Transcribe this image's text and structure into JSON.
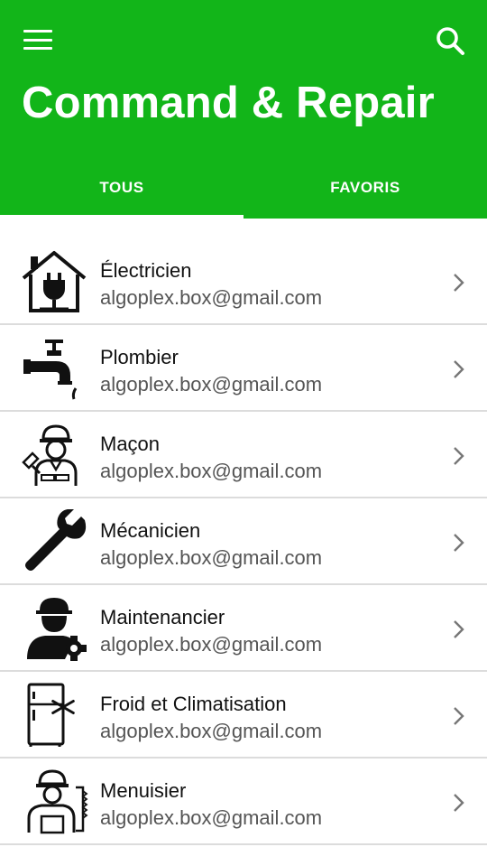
{
  "app": {
    "title": "Command & Repair",
    "accent_color": "#12b519",
    "menu_icon": "hamburger-menu-icon",
    "search_icon": "search-icon"
  },
  "tabs": [
    {
      "label": "TOUS",
      "active": true
    },
    {
      "label": "FAVORIS",
      "active": false
    }
  ],
  "items": [
    {
      "name": "Électricien",
      "email": "algoplex.box@gmail.com",
      "icon": "house-plug-icon"
    },
    {
      "name": "Plombier",
      "email": "algoplex.box@gmail.com",
      "icon": "faucet-icon"
    },
    {
      "name": "Maçon",
      "email": "algoplex.box@gmail.com",
      "icon": "mason-worker-icon"
    },
    {
      "name": "Mécanicien",
      "email": "algoplex.box@gmail.com",
      "icon": "wrench-icon"
    },
    {
      "name": "Maintenancier",
      "email": "algoplex.box@gmail.com",
      "icon": "maintenance-worker-icon"
    },
    {
      "name": "Froid et Climatisation",
      "email": "algoplex.box@gmail.com",
      "icon": "fridge-snowflake-icon"
    },
    {
      "name": "Menuisier",
      "email": "algoplex.box@gmail.com",
      "icon": "carpenter-worker-icon"
    }
  ]
}
